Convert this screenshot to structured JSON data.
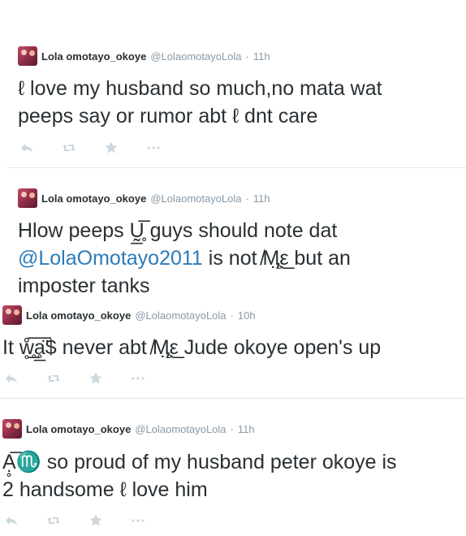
{
  "tweets": [
    {
      "name": "Lola omotayo_okoye",
      "handle": "@LolaomotayoLola",
      "separator": "·",
      "time": "11h",
      "lines": [
        "ℓ love my husband so much,no mata wat",
        "peeps say or rumor abt  ℓ dnt care"
      ]
    },
    {
      "name": "Lola omotayo_okoye",
      "handle": "@LolaomotayoLola",
      "separator": "·",
      "time": "11h",
      "line1": "Hlow peeps Ṵ̲̥̅ guys should note dat",
      "mention": "@LolaOmotayo2011",
      "line2_rest": " is not  ̸Ӎ̣̣̥ε̲̣̣̣ but an",
      "line3": "imposter tanks"
    },
    {
      "name": "Lola omotayo_okoye",
      "handle": "@LolaomotayoLola",
      "separator": "·",
      "time": "10h",
      "lines": [
        "It ẘ̥̥̲̅ḁ̲̈̅$ never abt  ̸Ӎ̣̣̥ε̲̣̣̣ Jude okoye open's up"
      ]
    },
    {
      "name": "Lola omotayo_okoye",
      "handle": "@LolaomotayoLola",
      "separator": "·",
      "time": "11h",
      "lines": [
        "Ạ̥̅♏ so proud of my husband peter okoye is",
        "2 handsome  ℓ love him"
      ]
    }
  ],
  "actions": {
    "reply_icon": "reply-icon",
    "retweet_icon": "retweet-icon",
    "favorite_icon": "favorite-icon",
    "more_icon": "more-icon"
  },
  "colors": {
    "text": "#292f33",
    "meta": "#8899a6",
    "mention": "#2b7bb9",
    "action_icon": "#ccd6dd",
    "divider": "#e1e8ed"
  }
}
